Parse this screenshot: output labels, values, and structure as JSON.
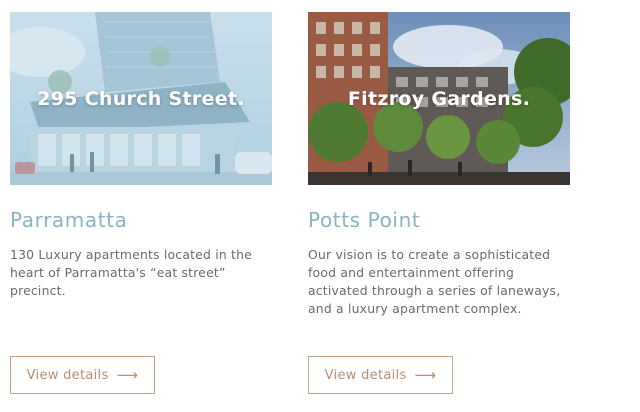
{
  "projects": [
    {
      "image_title": "295 Church Street.",
      "location": "Parramatta",
      "description": "130 Luxury apartments located in the heart of Parramatta's “eat street” precinct.",
      "button_label": "View details",
      "arrow_icon": "⟶"
    },
    {
      "image_title": "Fitzroy Gardens.",
      "location": "Potts Point",
      "description": "Our vision is to create a sophisticated food and entertainment offering activated through a series of laneways, and a luxury apartment complex.",
      "button_label": "View details",
      "arrow_icon": "⟶"
    }
  ],
  "colors": {
    "location_text": "#8ab4c4",
    "button_border": "#c9a28c",
    "button_text": "#b88e76",
    "body_text": "#6b6b6b"
  }
}
